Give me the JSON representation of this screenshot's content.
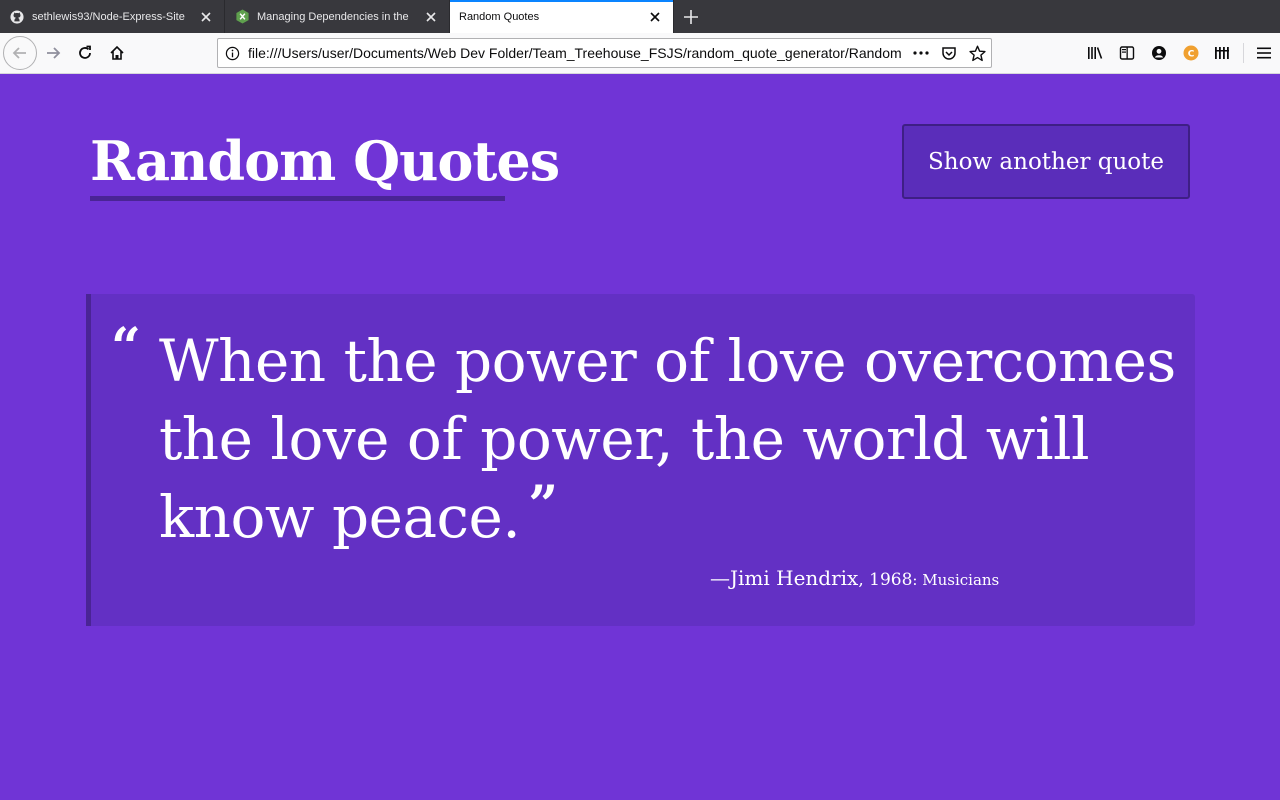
{
  "browser": {
    "tabs": [
      {
        "title": "sethlewis93/Node-Express-Site",
        "icon": "github-icon",
        "active": false
      },
      {
        "title": "Managing Dependencies in the",
        "icon": "node-icon",
        "active": false
      },
      {
        "title": "Random Quotes",
        "icon": "none",
        "active": true
      }
    ],
    "url": "file:///Users/user/Documents/Web Dev Folder/Team_Treehouse_FSJS/random_quote_generator/Random",
    "accent_color": "#0a84ff"
  },
  "page": {
    "background_color": "#7034d6",
    "title": "Random Quotes",
    "button_label": "Show another quote",
    "quote": {
      "open_mark": "“",
      "text": "When the power of love overcomes the love of power, the world will know peace.",
      "close_mark": "”",
      "source": "—Jimi Hendrix",
      "year": ", 1968",
      "tags": ": Musicians"
    }
  }
}
